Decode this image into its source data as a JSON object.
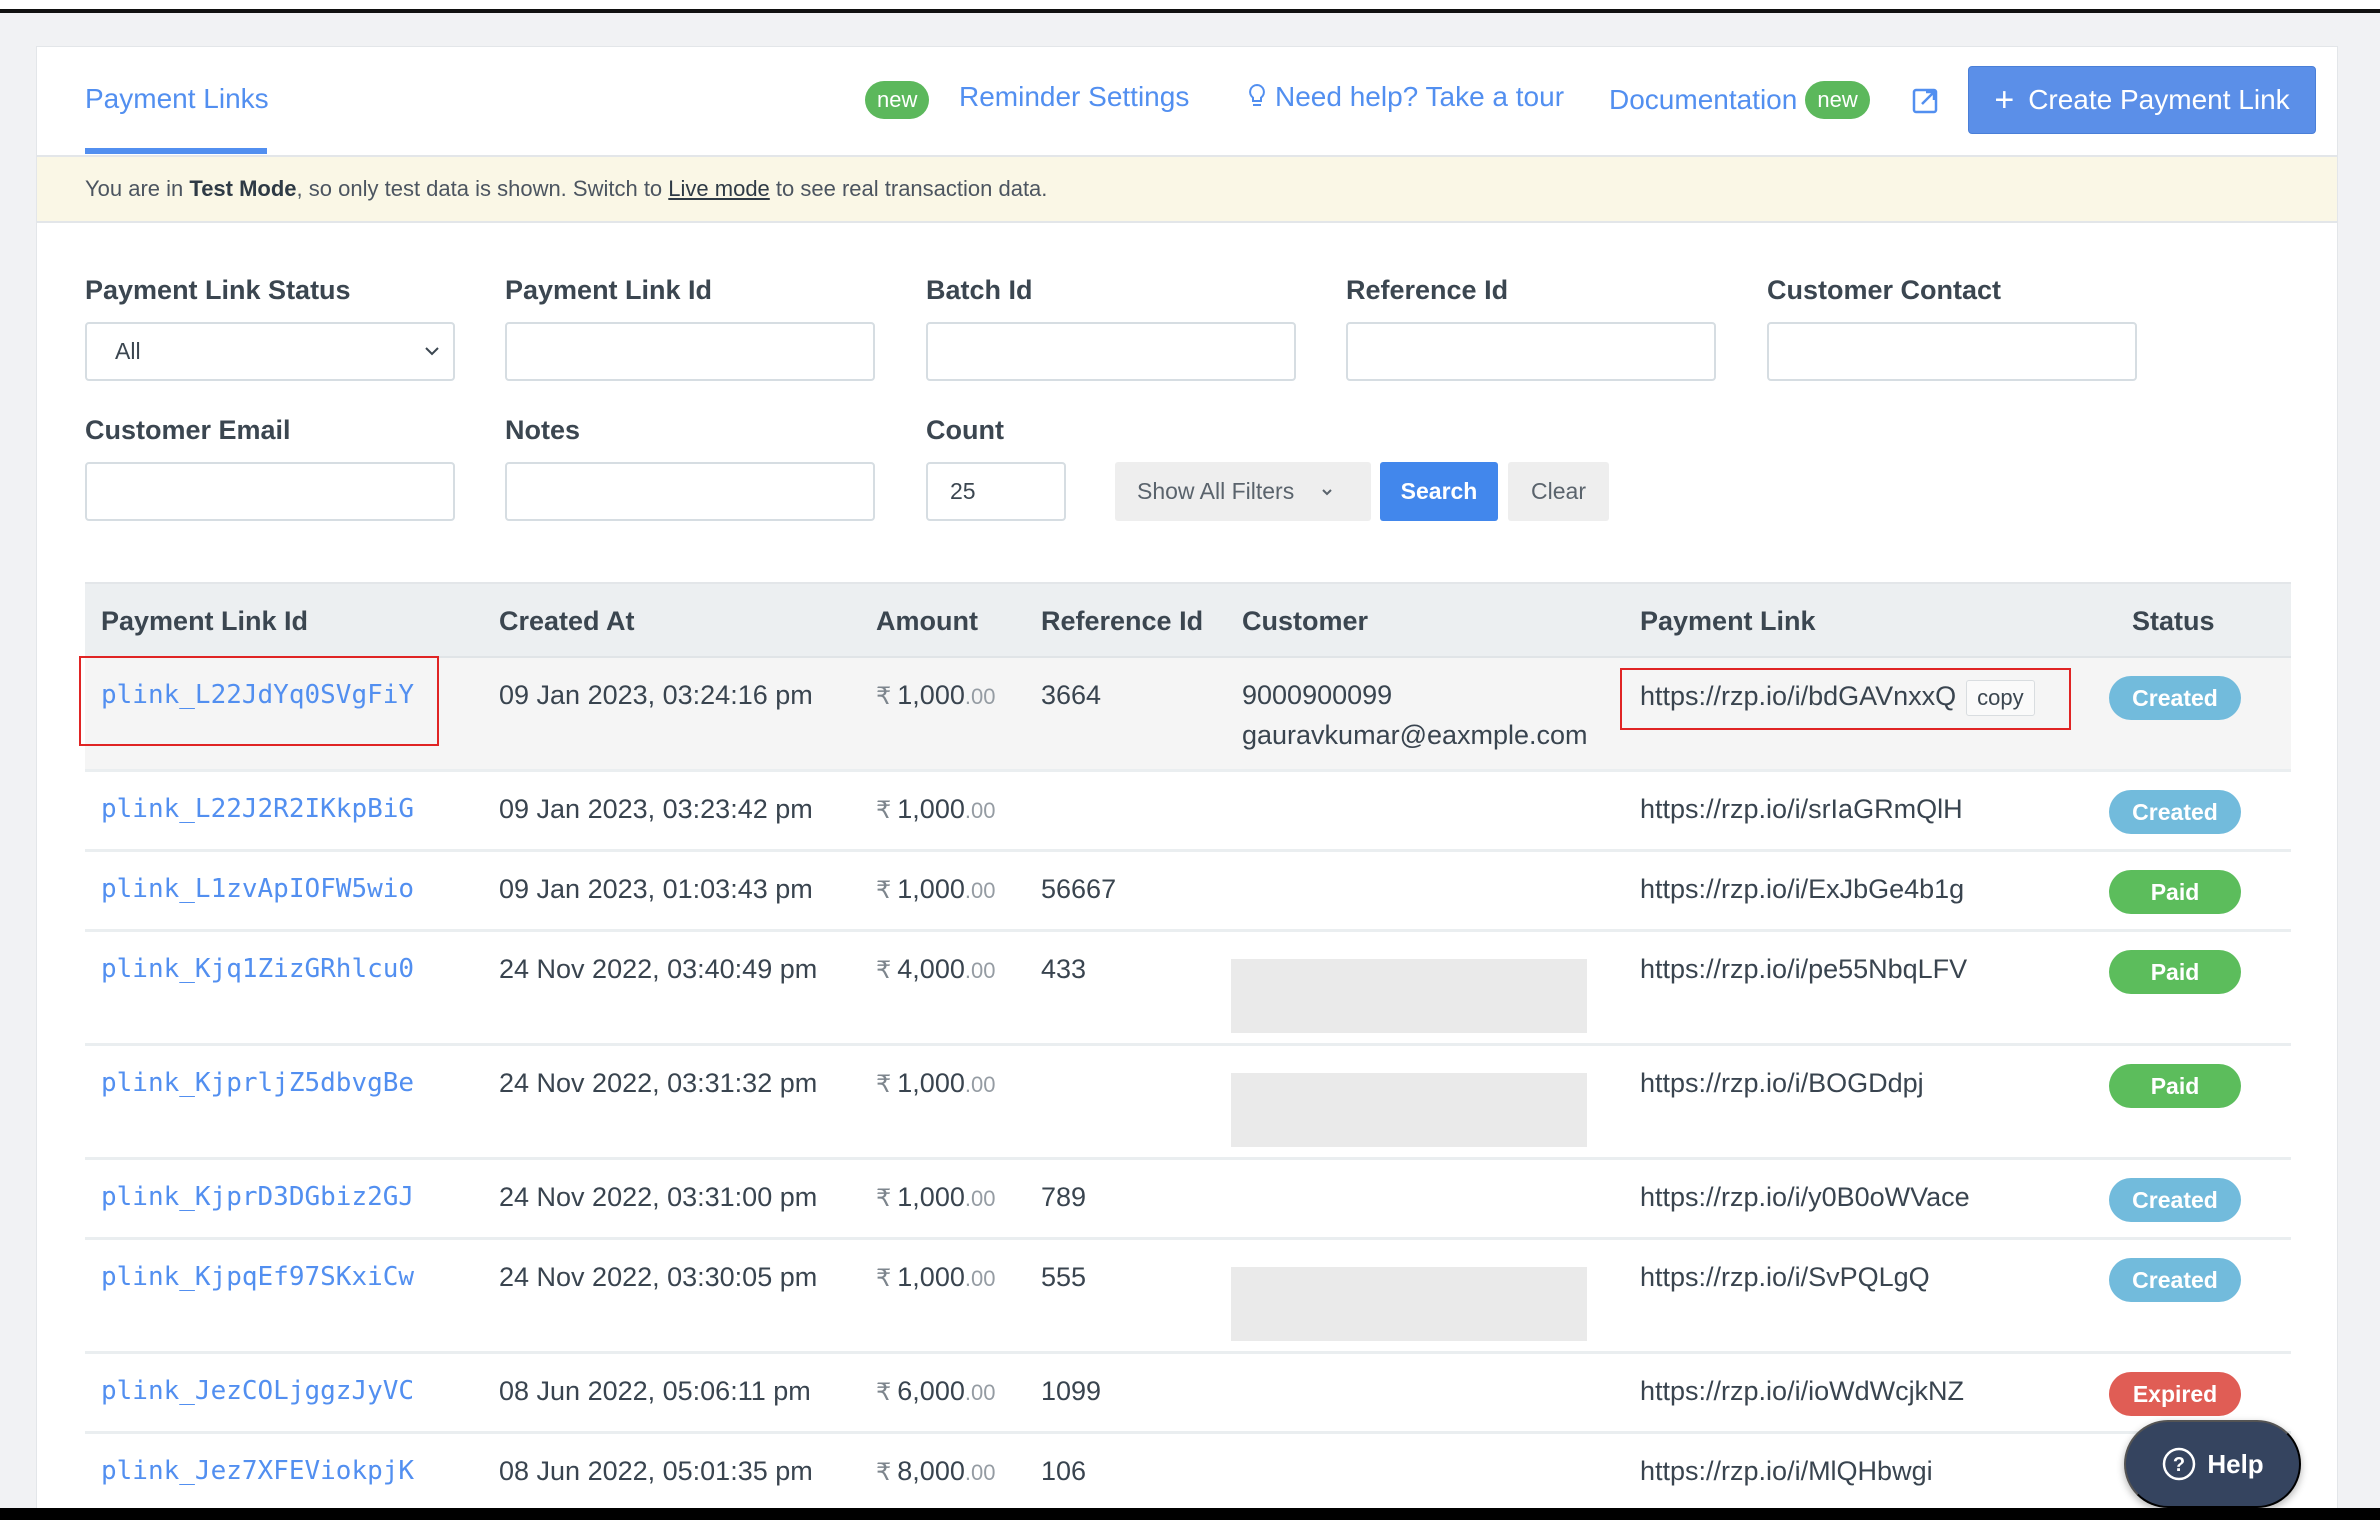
{
  "header": {
    "active_tab": "Payment Links",
    "new_badge": "new",
    "reminder_settings": "Reminder Settings",
    "tour_link": "Need help? Take a tour",
    "documentation": "Documentation",
    "create_button": "Create Payment Link",
    "icons": {
      "tour": "lightbulb-icon",
      "external": "external-link-icon",
      "create": "plus-icon"
    }
  },
  "banner": {
    "prefix": "You are in ",
    "mode": "Test Mode",
    "middle": ", so only test data is shown. Switch to ",
    "link": "Live mode",
    "suffix": " to see real transaction data."
  },
  "filters": {
    "status": {
      "label": "Payment Link Status",
      "value": "All"
    },
    "payment_link_id": {
      "label": "Payment Link Id",
      "value": ""
    },
    "batch_id": {
      "label": "Batch Id",
      "value": ""
    },
    "reference_id": {
      "label": "Reference Id",
      "value": ""
    },
    "customer_contact": {
      "label": "Customer Contact",
      "value": ""
    },
    "customer_email": {
      "label": "Customer Email",
      "value": ""
    },
    "notes": {
      "label": "Notes",
      "value": ""
    },
    "count": {
      "label": "Count",
      "value": "25"
    },
    "show_all_filters": "Show All Filters",
    "search": "Search",
    "clear": "Clear"
  },
  "table": {
    "columns": [
      "Payment Link Id",
      "Created At",
      "Amount",
      "Reference Id",
      "Customer",
      "Payment Link",
      "Status"
    ],
    "currency_symbol": "₹",
    "copy_label": "copy",
    "rows": [
      {
        "id": "plink_L22JdYq0SVgFiY",
        "created": "09 Jan 2023, 03:24:16 pm",
        "amount": "1,000",
        "decimals": ".00",
        "ref": "3664",
        "customer_phone": "9000900099",
        "customer_email": "gauravkumar@eaxmple.com",
        "link": "https://rzp.io/i/bdGAVnxxQ",
        "status": "Created"
      },
      {
        "id": "plink_L22J2R2IKkpBiG",
        "created": "09 Jan 2023, 03:23:42 pm",
        "amount": "1,000",
        "decimals": ".00",
        "ref": "",
        "link": "https://rzp.io/i/srIaGRmQlH",
        "status": "Created"
      },
      {
        "id": "plink_L1zvApIOFW5wio",
        "created": "09 Jan 2023, 01:03:43 pm",
        "amount": "1,000",
        "decimals": ".00",
        "ref": "56667",
        "link": "https://rzp.io/i/ExJbGe4b1g",
        "status": "Paid"
      },
      {
        "id": "plink_Kjq1ZizGRhlcu0",
        "created": "24 Nov 2022, 03:40:49 pm",
        "amount": "4,000",
        "decimals": ".00",
        "ref": "433",
        "link": "https://rzp.io/i/pe55NbqLFV",
        "status": "Paid"
      },
      {
        "id": "plink_KjprljZ5dbvgBe",
        "created": "24 Nov 2022, 03:31:32 pm",
        "amount": "1,000",
        "decimals": ".00",
        "ref": "",
        "link": "https://rzp.io/i/BOGDdpj",
        "status": "Paid"
      },
      {
        "id": "plink_KjprD3DGbiz2GJ",
        "created": "24 Nov 2022, 03:31:00 pm",
        "amount": "1,000",
        "decimals": ".00",
        "ref": "789",
        "link": "https://rzp.io/i/y0B0oWVace",
        "status": "Created"
      },
      {
        "id": "plink_KjpqEf97SKxiCw",
        "created": "24 Nov 2022, 03:30:05 pm",
        "amount": "1,000",
        "decimals": ".00",
        "ref": "555",
        "link": "https://rzp.io/i/SvPQLgQ",
        "status": "Created"
      },
      {
        "id": "plink_JezCOLjggzJyVC",
        "created": "08 Jun 2022, 05:06:11 pm",
        "amount": "6,000",
        "decimals": ".00",
        "ref": "1099",
        "link": "https://rzp.io/i/ioWdWcjkNZ",
        "status": "Expired"
      },
      {
        "id": "plink_Jez7XFEViokpjK",
        "created": "08 Jun 2022, 05:01:35 pm",
        "amount": "8,000",
        "decimals": ".00",
        "ref": "106",
        "link": "https://rzp.io/i/MlQHbwgi",
        "status": ""
      }
    ]
  },
  "status_colors": {
    "Created": "#72bbdc",
    "Paid": "#5cbd5c",
    "Expired": "#e05d55"
  },
  "accent_color": "#528ff0",
  "help_button": "Help"
}
